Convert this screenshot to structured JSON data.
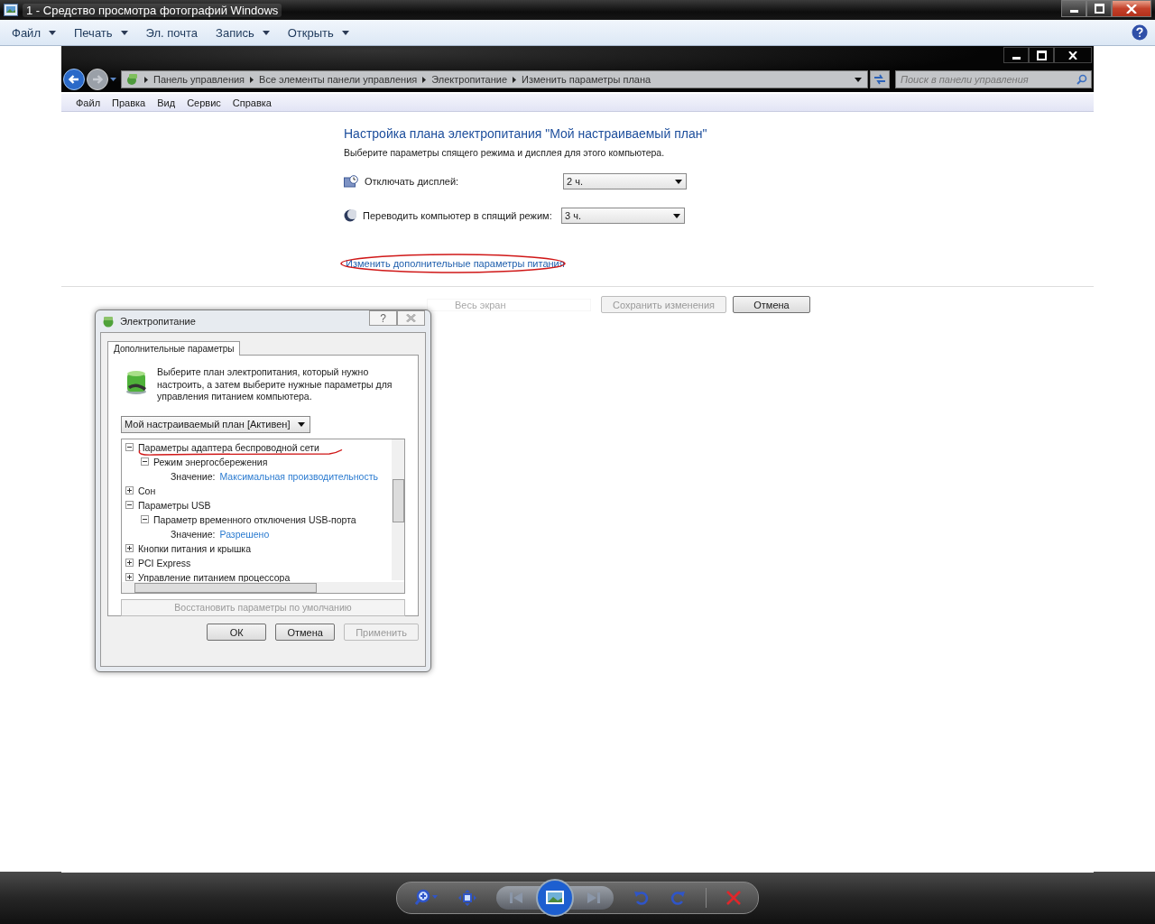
{
  "viewer": {
    "title": "1 - Средство просмотра фотографий Windows",
    "menu": [
      {
        "label": "Файл",
        "has_menu": true
      },
      {
        "label": "Печать",
        "has_menu": true
      },
      {
        "label": "Эл. почта",
        "has_menu": false
      },
      {
        "label": "Запись",
        "has_menu": true
      },
      {
        "label": "Открыть",
        "has_menu": true
      }
    ]
  },
  "screenshot": {
    "address": [
      "Панель управления",
      "Все элементы панели управления",
      "Электропитание",
      "Изменить параметры плана"
    ],
    "search": {
      "placeholder": "Поиск в панели управления"
    },
    "menu": [
      "Файл",
      "Правка",
      "Вид",
      "Сервис",
      "Справка"
    ],
    "heading": "Настройка плана электропитания \"Мой настраиваемый план\"",
    "subtitle": "Выберите параметры спящего режима и дисплея для этого компьютера.",
    "settings": [
      {
        "kind": "display",
        "label": "Отключать дисплей:",
        "value": "2 ч."
      },
      {
        "kind": "sleep",
        "label": "Переводить компьютер в спящий режим:",
        "value": "3 ч."
      }
    ],
    "link": "Изменить дополнительные параметры питания",
    "tooltip": "Весь экран",
    "buttons": [
      {
        "label": "Сохранить изменения",
        "disabled": true
      },
      {
        "label": "Отмена",
        "disabled": false
      }
    ],
    "dialog": {
      "title": "Электропитание",
      "help": "?",
      "tabs": [
        {
          "label": "Дополнительные параметры",
          "selected": true
        }
      ],
      "description": "Выберите план электропитания, который нужно настроить, а затем выберите нужные параметры для управления питанием компьютера.",
      "plan": "Мой настраиваемый план [Активен]",
      "tree": [
        {
          "kind": "group",
          "label": "Параметры адаптера беспроводной сети",
          "expanded": true,
          "children": [
            {
              "kind": "group",
              "label": "Режим энергосбережения",
              "expanded": true,
              "children": [
                {
                  "kind": "value",
                  "label": "Значение:",
                  "value": "Максимальная производительность"
                }
              ]
            }
          ]
        },
        {
          "kind": "group",
          "label": "Сон",
          "expanded": false
        },
        {
          "kind": "group",
          "label": "Параметры USB",
          "expanded": true,
          "children": [
            {
              "kind": "group",
              "label": "Параметр временного отключения USB-порта",
              "expanded": true,
              "children": [
                {
                  "kind": "value",
                  "label": "Значение:",
                  "value": "Разрешено"
                }
              ]
            }
          ]
        },
        {
          "kind": "group",
          "label": "Кнопки питания и крышка",
          "expanded": false
        },
        {
          "kind": "group",
          "label": "PCI Express",
          "expanded": false
        },
        {
          "kind": "group",
          "label": "Управление питанием процессора",
          "expanded": false
        }
      ],
      "restore": {
        "label": "Восстановить параметры по умолчанию",
        "disabled": true
      },
      "buttons": [
        {
          "label": "ОК",
          "disabled": false
        },
        {
          "label": "Отмена",
          "disabled": false
        },
        {
          "label": "Применить",
          "disabled": true
        }
      ]
    }
  }
}
